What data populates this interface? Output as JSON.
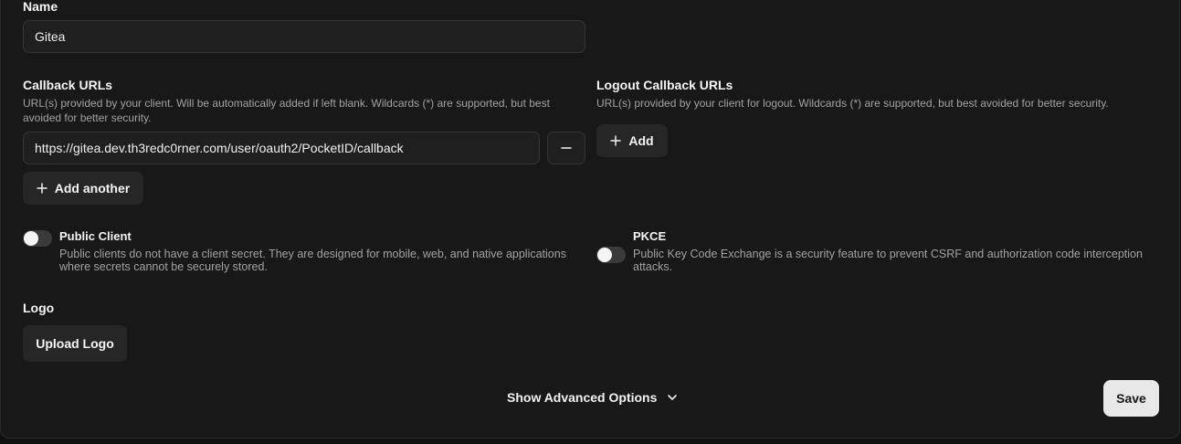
{
  "name": {
    "label": "Name",
    "value": "Gitea"
  },
  "callback": {
    "label": "Callback URLs",
    "description_line1": "URL(s) provided by your client. Will be automatically added if left blank. Wildcards (*) are supported, but best",
    "description_line2": "avoided for better security.",
    "urls": [
      "https://gitea.dev.th3redc0rner.com/user/oauth2/PocketID/callback"
    ],
    "add_label": "Add another"
  },
  "logout": {
    "label": "Logout Callback URLs",
    "description": "URL(s) provided by your client for logout. Wildcards (*) are supported, but best avoided for better security.",
    "add_label": "Add"
  },
  "public_client": {
    "label": "Public Client",
    "description_line1": "Public clients do not have a client secret. They are designed for mobile, web, and native applications",
    "description_line2": "where secrets cannot be securely stored.",
    "enabled": false
  },
  "pkce": {
    "label": "PKCE",
    "description_line1": "Public Key Code Exchange is a security feature to prevent CSRF and authorization code interception",
    "description_line2": "attacks.",
    "enabled": false
  },
  "logo": {
    "label": "Logo",
    "upload_label": "Upload Logo"
  },
  "advanced": {
    "label": "Show Advanced Options"
  },
  "save_label": "Save"
}
